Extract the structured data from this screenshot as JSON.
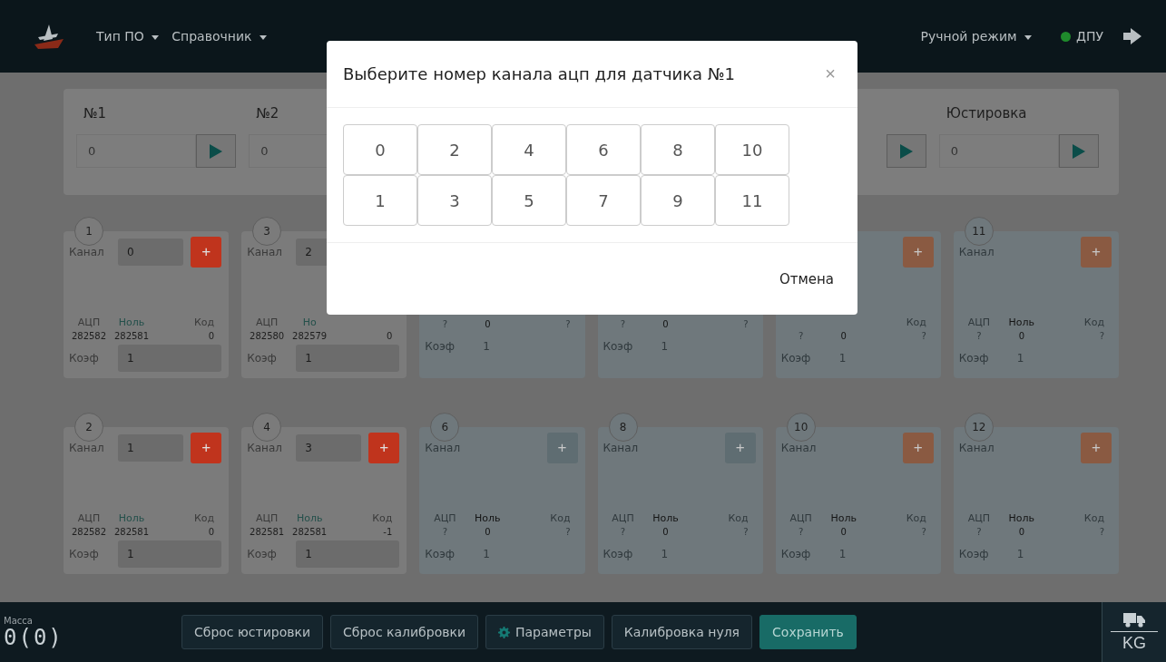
{
  "navbar": {
    "menus": [
      {
        "label": "Тип ПО"
      },
      {
        "label": "Справочник"
      }
    ],
    "mode_menu": "Ручной режим",
    "connection": {
      "label": "ДПУ",
      "online": true
    }
  },
  "sensors": [
    {
      "kind": "field",
      "label": "№1",
      "value": "0"
    },
    {
      "kind": "field",
      "label": "№2",
      "value": "0"
    },
    {
      "kind": "hidden"
    },
    {
      "kind": "hidden"
    },
    {
      "kind": "button_only"
    },
    {
      "kind": "field",
      "label": "Юстировка",
      "value": "0"
    }
  ],
  "cards": [
    {
      "active": true,
      "number": "1",
      "channel_label": "Канал",
      "channel": "0",
      "color": "#c0341d",
      "plus": "+",
      "adc_label": "АЦП",
      "zero_label": "Ноль",
      "code_label": "Код",
      "adc": "282582",
      "zero": "282581",
      "code": "0",
      "coef_label": "Коэф",
      "coef": "1"
    },
    {
      "active": true,
      "number": "3",
      "channel_label": "Канал",
      "channel": "2",
      "adc_label": "АЦП",
      "zero_label": "Но",
      "adc": "282580",
      "zero": "282579",
      "code": "0",
      "coef_label": "Коэф",
      "coef": "1"
    },
    {
      "active": false,
      "adc": "?",
      "zero": "0",
      "code": "?",
      "coef_label": "Коэф",
      "coef": "1"
    },
    {
      "active": false,
      "adc": "?",
      "zero": "0",
      "code": "?",
      "coef_label": "Коэф",
      "coef": "1"
    },
    {
      "active": false,
      "color": "#8a5a42",
      "plus": "+",
      "code_label": "Код",
      "adc": "?",
      "zero": "0",
      "code": "?",
      "coef_label": "Коэф",
      "coef": "1"
    },
    {
      "active": false,
      "number": "11",
      "channel_label": "Канал",
      "color": "#8a5a42",
      "plus": "+",
      "adc_label": "АЦП",
      "zero_label": "Ноль",
      "code_label": "Код",
      "adc": "?",
      "zero": "0",
      "code": "?",
      "coef_label": "Коэф",
      "coef": "1"
    },
    {
      "active": true,
      "number": "2",
      "channel_label": "Канал",
      "channel": "1",
      "color": "#c0341d",
      "plus": "+",
      "adc_label": "АЦП",
      "zero_label": "Ноль",
      "code_label": "Код",
      "adc": "282582",
      "zero": "282581",
      "code": "0",
      "coef_label": "Коэф",
      "coef": "1"
    },
    {
      "active": true,
      "number": "4",
      "channel_label": "Канал",
      "channel": "3",
      "color": "#c0341d",
      "plus": "+",
      "adc_label": "АЦП",
      "zero_label": "Ноль",
      "code_label": "Код",
      "adc": "282581",
      "zero": "282581",
      "code": "-1",
      "coef_label": "Коэф",
      "coef": "1"
    },
    {
      "active": false,
      "number": "6",
      "channel_label": "Канал",
      "color": "#5f6d72",
      "plus": "+",
      "adc_label": "АЦП",
      "zero_label": "Ноль",
      "code_label": "Код",
      "adc": "?",
      "zero": "0",
      "code": "?",
      "coef_label": "Коэф",
      "coef": "1"
    },
    {
      "active": false,
      "number": "8",
      "channel_label": "Канал",
      "color": "#5f6d72",
      "plus": "+",
      "adc_label": "АЦП",
      "zero_label": "Ноль",
      "code_label": "Код",
      "adc": "?",
      "zero": "0",
      "code": "?",
      "coef_label": "Коэф",
      "coef": "1"
    },
    {
      "active": false,
      "number": "10",
      "channel_label": "Канал",
      "color": "#8a5a42",
      "plus": "+",
      "adc_label": "АЦП",
      "zero_label": "Ноль",
      "code_label": "Код",
      "adc": "?",
      "zero": "0",
      "code": "?",
      "coef_label": "Коэф",
      "coef": "1"
    },
    {
      "active": false,
      "number": "12",
      "channel_label": "Канал",
      "color": "#8a5a42",
      "plus": "+",
      "adc_label": "АЦП",
      "zero_label": "Ноль",
      "code_label": "Код",
      "adc": "?",
      "zero": "0",
      "code": "?",
      "coef_label": "Коэф",
      "coef": "1"
    }
  ],
  "footer": {
    "mass_label": "Масса",
    "mass_value": "0(0)",
    "buttons": [
      {
        "label": "Сброс юстировки",
        "kind": "plain"
      },
      {
        "label": "Сброс калибровки",
        "kind": "plain"
      },
      {
        "label": "Параметры",
        "kind": "gear"
      },
      {
        "label": "Калибровка нуля",
        "kind": "plain"
      },
      {
        "label": "Сохранить",
        "kind": "primary"
      }
    ],
    "unit": "KG"
  },
  "modal": {
    "title": "Выберите номер канала ацп для датчика №1",
    "close": "×",
    "channels": [
      "0",
      "1",
      "2",
      "3",
      "4",
      "5",
      "6",
      "7",
      "8",
      "9",
      "10",
      "11"
    ],
    "cancel": "Отмена"
  }
}
